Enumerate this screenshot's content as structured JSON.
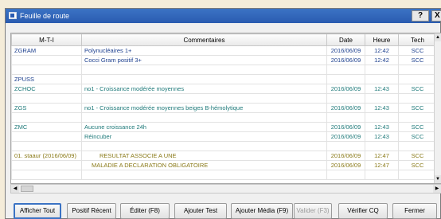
{
  "window": {
    "title": "Feuille de route",
    "help_label": "?",
    "close_label": "X"
  },
  "table": {
    "columns": [
      "M-T-I",
      "Commentaires",
      "Date",
      "Heure",
      "Tech"
    ],
    "rows": [
      {
        "color": "blue",
        "indent": "",
        "mti": "ZGRAM",
        "comment": "Polynucléaires   1+",
        "date": "2016/06/09",
        "heure": "12:42",
        "tech": "SCC"
      },
      {
        "color": "blue",
        "indent": "",
        "mti": "",
        "comment": "Cocci  Gram positif  3+",
        "date": "2016/06/09",
        "heure": "12:42",
        "tech": "SCC"
      },
      {
        "color": "blue",
        "indent": "",
        "mti": "",
        "comment": "",
        "date": "",
        "heure": "",
        "tech": ""
      },
      {
        "color": "blue",
        "indent": "",
        "mti": "ZPUSS",
        "comment": "",
        "date": "",
        "heure": "",
        "tech": ""
      },
      {
        "color": "teal",
        "indent": "",
        "mti": "ZCHOC",
        "comment": "no1 -  Croissance modérée  moyennes",
        "date": "2016/06/09",
        "heure": "12:43",
        "tech": "SCC"
      },
      {
        "color": "teal",
        "indent": "",
        "mti": "",
        "comment": "",
        "date": "",
        "heure": "",
        "tech": ""
      },
      {
        "color": "teal",
        "indent": "",
        "mti": "ZGS",
        "comment": "no1 -  Croissance modérée  moyennes beiges B-hémolytique",
        "date": "2016/06/09",
        "heure": "12:43",
        "tech": "SCC"
      },
      {
        "color": "teal",
        "indent": "",
        "mti": "",
        "comment": "",
        "date": "",
        "heure": "",
        "tech": ""
      },
      {
        "color": "teal",
        "indent": "",
        "mti": "ZMC",
        "comment": "Aucune croissance 24h",
        "date": "2016/06/09",
        "heure": "12:43",
        "tech": "SCC"
      },
      {
        "color": "teal",
        "indent": "",
        "mti": "",
        "comment": "Réincuber",
        "date": "2016/06/09",
        "heure": "12:43",
        "tech": "SCC"
      },
      {
        "color": "gold",
        "indent": "",
        "mti": "",
        "comment": "",
        "date": "",
        "heure": "",
        "tech": ""
      },
      {
        "color": "gold",
        "indent": "indent",
        "mti": "01. staaur (2016/06/09)",
        "comment": "RESULTAT ASSOCIE A UNE",
        "date": "2016/06/09",
        "heure": "12:47",
        "tech": "SCC"
      },
      {
        "color": "gold",
        "indent": "indent2",
        "mti": "",
        "comment": "MALADIE A DECLARATION OBLIGATOIRE",
        "date": "2016/06/09",
        "heure": "12:47",
        "tech": "SCC"
      },
      {
        "color": "gold",
        "indent": "",
        "mti": "",
        "comment": "",
        "date": "",
        "heure": "",
        "tech": ""
      }
    ]
  },
  "buttons": {
    "show_all": "Afficher Tout",
    "recent_positive": "Positif Récent",
    "edit": "Éditer (F8)",
    "add_test": "Ajouter Test",
    "add_media": "Ajouter Média (F9)",
    "validate": "Valider (F3)",
    "verify_cq": "Vérifier CQ",
    "close": "Fermer"
  },
  "colors": {
    "titlebar": "#2a5bb0",
    "text_blue": "#1c3f8e",
    "text_teal": "#1f7a7a",
    "text_gold": "#8a7a18"
  }
}
